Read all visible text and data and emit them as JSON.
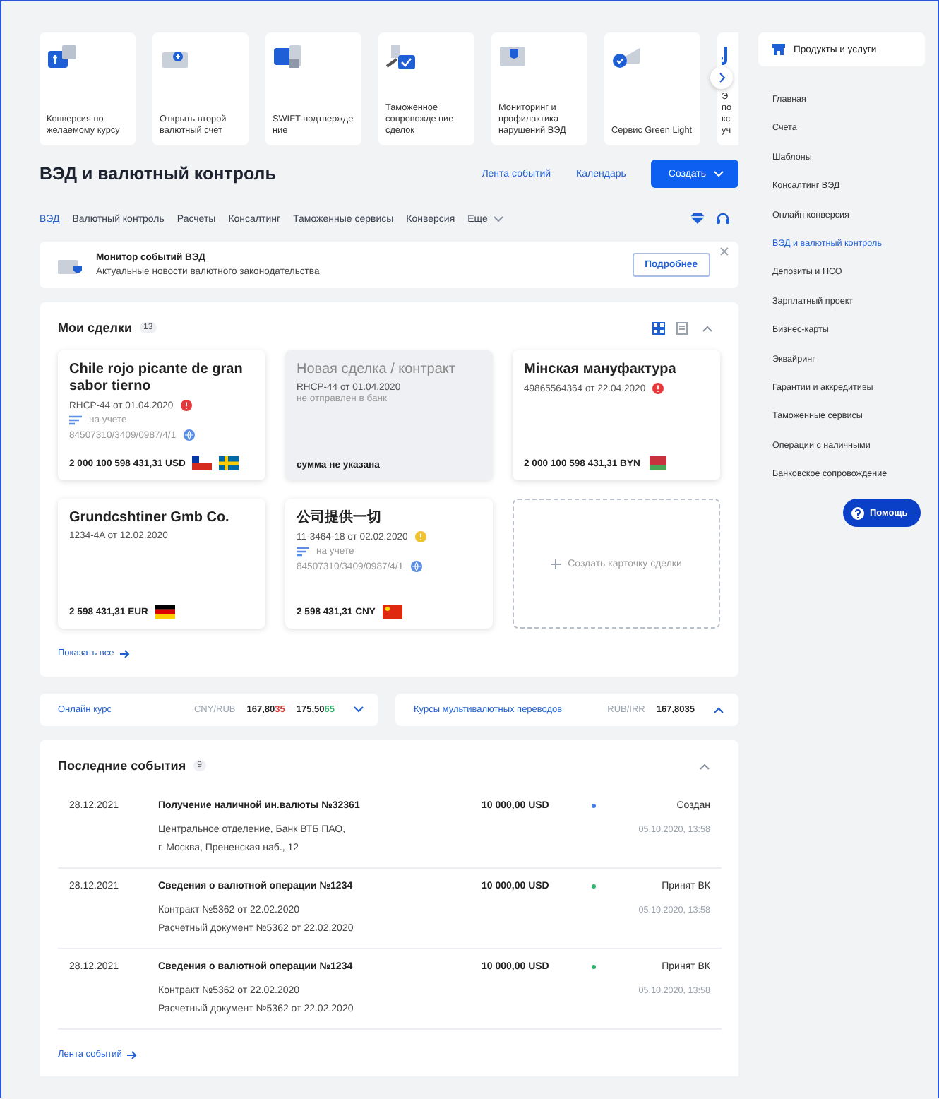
{
  "services": [
    {
      "label": "Конверсия по желаемому курсу"
    },
    {
      "label": "Открыть второй валютный счет"
    },
    {
      "label": "SWIFT-подтвержде ние"
    },
    {
      "label": "Таможенное сопровожде ние сделок"
    },
    {
      "label": "Мониторинг и профилактика нарушений ВЭД"
    },
    {
      "label": "Сервис Green Light"
    },
    {
      "label": "Э по кс уч"
    }
  ],
  "header": {
    "title": "ВЭД и валютный контроль",
    "links": [
      "Лента событий",
      "Календарь"
    ],
    "create_button": "Создать"
  },
  "tabs": [
    {
      "label": "ВЭД",
      "selected": true,
      "dropdown": false
    },
    {
      "label": "Валютный контроль",
      "selected": false,
      "dropdown": false
    },
    {
      "label": "Расчеты",
      "selected": false,
      "dropdown": false
    },
    {
      "label": "Консалтинг",
      "selected": false,
      "dropdown": false
    },
    {
      "label": "Таможенные сервисы",
      "selected": false,
      "dropdown": false
    },
    {
      "label": "Конверсия",
      "selected": false,
      "dropdown": false
    },
    {
      "label": "Еще",
      "selected": false,
      "dropdown": true
    }
  ],
  "banner": {
    "title": "Монитор событий ВЭД",
    "text": "Актуальные новости валютного законодательства",
    "button": "Подробнее"
  },
  "deals": {
    "title": "Мои сделки",
    "count": "13",
    "expanded": true,
    "view_buttons": [
      {
        "kind": "grid",
        "selected": true
      },
      {
        "kind": "list",
        "selected": false
      }
    ],
    "cards": [
      {
        "kind": "deal",
        "title": "Chile rojo picante de gran sabor tierno",
        "contract": "RHCP-44 от 01.04.2020",
        "alert": {
          "color": "#e5393b"
        },
        "status": "на учете",
        "number": "84507310/3409/0987/4/1",
        "amount": "2 000 100 598 431,31 USD",
        "flags": [
          {
            "kind": "cl"
          },
          {
            "kind": "se"
          }
        ]
      },
      {
        "kind": "draft",
        "title": "Новая сделка / контракт",
        "contract": "RHCP-44 от 01.04.2020",
        "note": "не отправлен в банк",
        "amount": "сумма не указана"
      },
      {
        "kind": "deal",
        "title": "Мінская мануфактура",
        "contract": "49865564364 от 22.04.2020",
        "alert": {
          "color": "#e5393b"
        },
        "amount": "2 000 100 598 431,31 BYN",
        "flags": [
          {
            "kind": "by"
          }
        ]
      },
      {
        "kind": "deal",
        "title": "Grundcshtiner Gmb Co.",
        "contract": "1234-4A от 12.02.2020",
        "amount": "2 598 431,31 EUR",
        "flags": [
          {
            "kind": "de"
          }
        ]
      },
      {
        "kind": "deal",
        "title": "公司提供一切",
        "contract": "11-3464-18 от 02.02.2020",
        "alert": {
          "color": "#f2c12e"
        },
        "status": "на учете",
        "number": "84507310/3409/0987/4/1",
        "amount": "2 598 431,31 CNY",
        "flags": [
          {
            "kind": "cn"
          }
        ]
      },
      {
        "kind": "create",
        "label": "Создать карточку сделки"
      }
    ],
    "show_all": "Показать все"
  },
  "rates": [
    {
      "link": "Онлайн курс",
      "pair": "CNY/RUB",
      "expanded": false,
      "quotes": [
        {
          "main": "167,80",
          "tail": "35",
          "color": "#e5393b"
        },
        {
          "main": "175,50",
          "tail": "65",
          "color": "#2fb36b"
        }
      ]
    },
    {
      "link": "Курсы мультивалютных переводов",
      "pair": "RUB/IRR",
      "expanded": true,
      "quotes": [
        {
          "main": "167,8035"
        }
      ]
    }
  ],
  "events": {
    "title": "Последние события",
    "count": "9",
    "expanded": true,
    "rows": [
      {
        "date": "28.12.2021",
        "title": "Получение наличной ин.валюты №32361",
        "details": [
          "Центральное отделение, Банк ВТБ ПАО,",
          "г. Москва, Прененская наб., 12"
        ],
        "amount": "10 000,00 USD",
        "color": "#4a7fe0",
        "status": "Создан",
        "time": "05.10.2020, 13:58"
      },
      {
        "date": "28.12.2021",
        "title": "Сведения о валютной операции №1234",
        "details": [
          "Контракт №5362 от 22.02.2020",
          "Расчетный документ №5362 от 22.02.2020"
        ],
        "amount": "10 000,00 USD",
        "color": "#2fb36b",
        "status": "Принят ВК",
        "time": "05.10.2020, 13:58"
      },
      {
        "date": "28.12.2021",
        "title": "Сведения о валютной операции №1234",
        "details": [
          "Контракт №5362 от 22.02.2020",
          "Расчетный документ №5362 от 22.02.2020"
        ],
        "amount": "10 000,00 USD",
        "color": "#2fb36b",
        "status": "Принят ВК",
        "time": "05.10.2020, 13:58"
      }
    ],
    "footer_link": "Лента событий"
  },
  "sidebar": {
    "header": "Продукты и услуги",
    "items": [
      {
        "label": "Главная",
        "selected": false
      },
      {
        "label": "Счета",
        "selected": false
      },
      {
        "label": "Шаблоны",
        "selected": false
      },
      {
        "label": "Консалтинг ВЭД",
        "selected": false
      },
      {
        "label": "Онлайн конверсия",
        "selected": false
      },
      {
        "label": "ВЭД и валютный контроль",
        "selected": true
      },
      {
        "label": "Депозиты и НСО",
        "selected": false
      },
      {
        "label": "Зарплатный проект",
        "selected": false
      },
      {
        "label": "Бизнес-карты",
        "selected": false
      },
      {
        "label": "Эквайринг",
        "selected": false
      },
      {
        "label": "Гарантии и аккредитивы",
        "selected": false
      },
      {
        "label": "Таможенные сервисы",
        "selected": false
      },
      {
        "label": "Операции с наличными",
        "selected": false
      },
      {
        "label": "Банковское сопровождение",
        "selected": false
      }
    ],
    "help": "Помощь"
  }
}
